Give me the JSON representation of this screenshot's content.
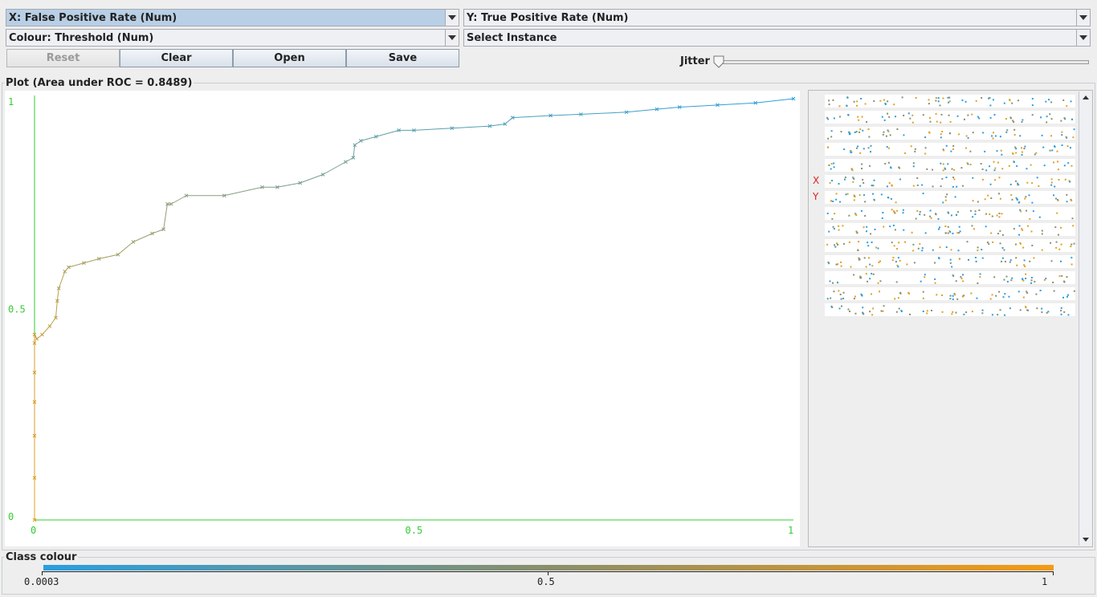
{
  "controls": {
    "x_axis": "X: False Positive Rate (Num)",
    "y_axis": "Y: True Positive Rate (Num)",
    "colour": "Colour: Threshold (Num)",
    "instance": "Select Instance"
  },
  "buttons": {
    "reset": "Reset",
    "clear": "Clear",
    "open": "Open",
    "save": "Save"
  },
  "jitter": {
    "label": "Jitter",
    "value": 0
  },
  "plot": {
    "title": "Plot (Area under ROC = 0.8489)"
  },
  "matrix": {
    "x_marker": "X",
    "y_marker": "Y",
    "rows": 14
  },
  "class_colour": {
    "title": "Class colour",
    "min_label": "0.0003",
    "mid_label": "0.5",
    "max_label": "1",
    "color_low": "#2a9fe0",
    "color_high": "#f59a14"
  },
  "colors": {
    "axis": "#33cc33",
    "low_threshold": "#2a9fe0",
    "high_threshold": "#e0a020"
  },
  "chart_data": {
    "type": "line",
    "title": "Plot (Area under ROC = 0.8489)",
    "xlabel": "",
    "ylabel": "",
    "xlim": [
      0,
      1
    ],
    "ylim": [
      0,
      1
    ],
    "x_ticks": [
      "0",
      "0.5",
      "1"
    ],
    "y_ticks": [
      "0",
      "0.5",
      "1"
    ],
    "grid": false,
    "series": [
      {
        "x": [
          0,
          0,
          0,
          0,
          0,
          0,
          0,
          0.003,
          0.01,
          0.02,
          0.028,
          0.03,
          0.032,
          0.04,
          0.045,
          0.065,
          0.085,
          0.11,
          0.13,
          0.155,
          0.17,
          0.175,
          0.18,
          0.2,
          0.25,
          0.3,
          0.32,
          0.35,
          0.38,
          0.41,
          0.42,
          0.422,
          0.43,
          0.45,
          0.48,
          0.5,
          0.55,
          0.6,
          0.62,
          0.63,
          0.68,
          0.72,
          0.78,
          0.82,
          0.85,
          0.9,
          0.95,
          1
        ],
        "y": [
          0,
          0.1,
          0.2,
          0.28,
          0.35,
          0.42,
          0.44,
          0.43,
          0.44,
          0.46,
          0.48,
          0.52,
          0.55,
          0.59,
          0.6,
          0.61,
          0.62,
          0.63,
          0.66,
          0.68,
          0.69,
          0.75,
          0.75,
          0.77,
          0.77,
          0.79,
          0.79,
          0.8,
          0.82,
          0.85,
          0.86,
          0.89,
          0.9,
          0.91,
          0.925,
          0.925,
          0.93,
          0.935,
          0.94,
          0.955,
          0.96,
          0.963,
          0.968,
          0.975,
          0.98,
          0.985,
          0.99,
          1
        ]
      }
    ]
  }
}
